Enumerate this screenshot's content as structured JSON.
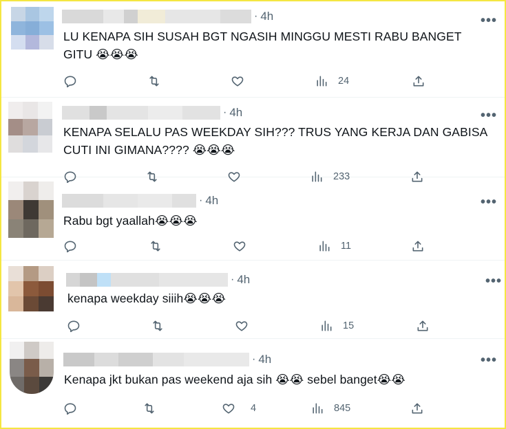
{
  "tweets": [
    {
      "time": "4h",
      "dot": "·",
      "text_line1": "LU KENAPA SIH SUSAH BGT NGASIH MINGGU MESTI RABU BANGET",
      "text_line2": "GITU 😭😭😭",
      "more": "•••",
      "views": "24",
      "likes": "",
      "retweets": "",
      "replies": ""
    },
    {
      "time": "4h",
      "dot": "·",
      "text_line1": "KENAPA SELALU PAS WEEKDAY SIH??? TRUS YANG KERJA DAN GABISA",
      "text_line2": "CUTI INI GIMANA???? 😭😭😭",
      "more": "•••",
      "views": "233",
      "likes": "",
      "retweets": "",
      "replies": ""
    },
    {
      "time": "4h",
      "dot": "·",
      "text_line1": "Rabu bgt yaallah😭😭😭",
      "text_line2": "",
      "more": "•••",
      "views": "11",
      "likes": "",
      "retweets": "",
      "replies": ""
    },
    {
      "time": "4h",
      "dot": "·",
      "text_line1": "kenapa weekday siiih😭😭😭",
      "text_line2": "",
      "more": "•••",
      "views": "15",
      "likes": "",
      "retweets": "",
      "replies": ""
    },
    {
      "time": "4h",
      "dot": "·",
      "text_line1": "Kenapa jkt bukan pas weekend aja sih 😭😭 sebel banget😭😭",
      "text_line2": "",
      "more": "•••",
      "views": "845",
      "likes": "4",
      "retweets": "",
      "replies": ""
    }
  ],
  "icons": {
    "reply": "reply-icon",
    "retweet": "retweet-icon",
    "like": "heart-icon",
    "views": "views-chart-icon",
    "share": "share-icon",
    "more": "more-icon"
  },
  "colors": {
    "text": "#0f1419",
    "muted": "#536471",
    "border": "#eff3f4",
    "frame": "#f5e642"
  }
}
